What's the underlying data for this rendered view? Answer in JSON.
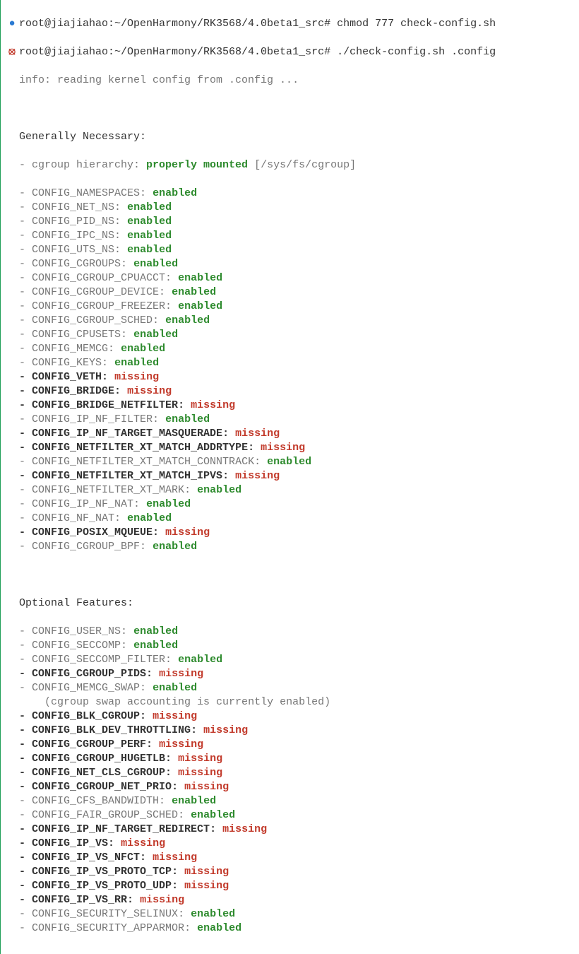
{
  "prompt1": {
    "bullet": "●",
    "prefix": "root@jiajiahao:~/OpenHarmony/RK3568/4.0beta1_src# ",
    "command": "chmod 777 check-config.sh"
  },
  "prompt2": {
    "bullet": "⦻",
    "prefix": "root@jiajiahao:~/OpenHarmony/RK3568/4.0beta1_src# ",
    "command": "./check-config.sh .config"
  },
  "info_line": "info: reading kernel config from .config ...",
  "section1_title": "Generally Necessary:",
  "cgroup_hierarchy": {
    "prefix": "- cgroup hierarchy: ",
    "status": "properly mounted",
    "suffix": " [/sys/fs/cgroup]"
  },
  "generally": [
    {
      "name": "CONFIG_NAMESPACES",
      "status": "enabled",
      "missing": false
    },
    {
      "name": "CONFIG_NET_NS",
      "status": "enabled",
      "missing": false
    },
    {
      "name": "CONFIG_PID_NS",
      "status": "enabled",
      "missing": false
    },
    {
      "name": "CONFIG_IPC_NS",
      "status": "enabled",
      "missing": false
    },
    {
      "name": "CONFIG_UTS_NS",
      "status": "enabled",
      "missing": false
    },
    {
      "name": "CONFIG_CGROUPS",
      "status": "enabled",
      "missing": false
    },
    {
      "name": "CONFIG_CGROUP_CPUACCT",
      "status": "enabled",
      "missing": false
    },
    {
      "name": "CONFIG_CGROUP_DEVICE",
      "status": "enabled",
      "missing": false
    },
    {
      "name": "CONFIG_CGROUP_FREEZER",
      "status": "enabled",
      "missing": false
    },
    {
      "name": "CONFIG_CGROUP_SCHED",
      "status": "enabled",
      "missing": false
    },
    {
      "name": "CONFIG_CPUSETS",
      "status": "enabled",
      "missing": false
    },
    {
      "name": "CONFIG_MEMCG",
      "status": "enabled",
      "missing": false
    },
    {
      "name": "CONFIG_KEYS",
      "status": "enabled",
      "missing": false
    },
    {
      "name": "CONFIG_VETH",
      "status": "missing",
      "missing": true
    },
    {
      "name": "CONFIG_BRIDGE",
      "status": "missing",
      "missing": true
    },
    {
      "name": "CONFIG_BRIDGE_NETFILTER",
      "status": "missing",
      "missing": true
    },
    {
      "name": "CONFIG_IP_NF_FILTER",
      "status": "enabled",
      "missing": false
    },
    {
      "name": "CONFIG_IP_NF_TARGET_MASQUERADE",
      "status": "missing",
      "missing": true
    },
    {
      "name": "CONFIG_NETFILTER_XT_MATCH_ADDRTYPE",
      "status": "missing",
      "missing": true
    },
    {
      "name": "CONFIG_NETFILTER_XT_MATCH_CONNTRACK",
      "status": "enabled",
      "missing": false
    },
    {
      "name": "CONFIG_NETFILTER_XT_MATCH_IPVS",
      "status": "missing",
      "missing": true
    },
    {
      "name": "CONFIG_NETFILTER_XT_MARK",
      "status": "enabled",
      "missing": false
    },
    {
      "name": "CONFIG_IP_NF_NAT",
      "status": "enabled",
      "missing": false
    },
    {
      "name": "CONFIG_NF_NAT",
      "status": "enabled",
      "missing": false
    },
    {
      "name": "CONFIG_POSIX_MQUEUE",
      "status": "missing",
      "missing": true
    },
    {
      "name": "CONFIG_CGROUP_BPF",
      "status": "enabled",
      "missing": false
    }
  ],
  "section2_title": "Optional Features:",
  "optional": [
    {
      "name": "CONFIG_USER_NS",
      "status": "enabled",
      "missing": false,
      "note": ""
    },
    {
      "name": "CONFIG_SECCOMP",
      "status": "enabled",
      "missing": false,
      "note": ""
    },
    {
      "name": "CONFIG_SECCOMP_FILTER",
      "status": "enabled",
      "missing": false,
      "note": ""
    },
    {
      "name": "CONFIG_CGROUP_PIDS",
      "status": "missing",
      "missing": true,
      "note": ""
    },
    {
      "name": "CONFIG_MEMCG_SWAP",
      "status": "enabled",
      "missing": false,
      "note": "(cgroup swap accounting is currently enabled)"
    },
    {
      "name": "CONFIG_BLK_CGROUP",
      "status": "missing",
      "missing": true,
      "note": ""
    },
    {
      "name": "CONFIG_BLK_DEV_THROTTLING",
      "status": "missing",
      "missing": true,
      "note": ""
    },
    {
      "name": "CONFIG_CGROUP_PERF",
      "status": "missing",
      "missing": true,
      "note": ""
    },
    {
      "name": "CONFIG_CGROUP_HUGETLB",
      "status": "missing",
      "missing": true,
      "note": ""
    },
    {
      "name": "CONFIG_NET_CLS_CGROUP",
      "status": "missing",
      "missing": true,
      "note": ""
    },
    {
      "name": "CONFIG_CGROUP_NET_PRIO",
      "status": "missing",
      "missing": true,
      "note": ""
    },
    {
      "name": "CONFIG_CFS_BANDWIDTH",
      "status": "enabled",
      "missing": false,
      "note": ""
    },
    {
      "name": "CONFIG_FAIR_GROUP_SCHED",
      "status": "enabled",
      "missing": false,
      "note": ""
    },
    {
      "name": "CONFIG_IP_NF_TARGET_REDIRECT",
      "status": "missing",
      "missing": true,
      "note": ""
    },
    {
      "name": "CONFIG_IP_VS",
      "status": "missing",
      "missing": true,
      "note": ""
    },
    {
      "name": "CONFIG_IP_VS_NFCT",
      "status": "missing",
      "missing": true,
      "note": ""
    },
    {
      "name": "CONFIG_IP_VS_PROTO_TCP",
      "status": "missing",
      "missing": true,
      "note": ""
    },
    {
      "name": "CONFIG_IP_VS_PROTO_UDP",
      "status": "missing",
      "missing": true,
      "note": ""
    },
    {
      "name": "CONFIG_IP_VS_RR",
      "status": "missing",
      "missing": true,
      "note": ""
    },
    {
      "name": "CONFIG_SECURITY_SELINUX",
      "status": "enabled",
      "missing": false,
      "note": ""
    },
    {
      "name": "CONFIG_SECURITY_APPARMOR",
      "status": "enabled",
      "missing": false,
      "note": ""
    }
  ]
}
